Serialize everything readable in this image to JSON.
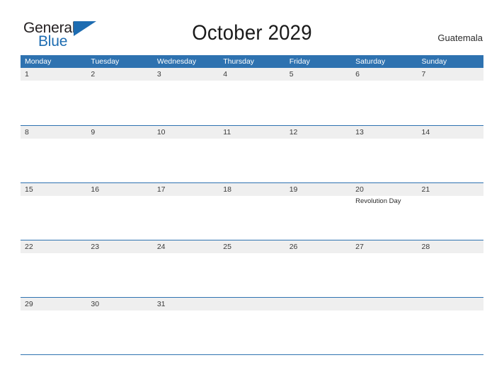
{
  "brand": {
    "name_part1": "General",
    "name_part2": "Blue",
    "triangle_icon": "triangle-icon",
    "accent_color": "#1d6cb1"
  },
  "header": {
    "title": "October 2029",
    "country": "Guatemala"
  },
  "colors": {
    "header_blue": "#2e72b0",
    "band_gray": "#efefef",
    "text_dark": "#3a3a3a"
  },
  "calendar": {
    "month": "October",
    "year": "2029",
    "weekdays": [
      "Monday",
      "Tuesday",
      "Wednesday",
      "Thursday",
      "Friday",
      "Saturday",
      "Sunday"
    ],
    "weeks": [
      {
        "days": [
          {
            "number": "1",
            "events": []
          },
          {
            "number": "2",
            "events": []
          },
          {
            "number": "3",
            "events": []
          },
          {
            "number": "4",
            "events": []
          },
          {
            "number": "5",
            "events": []
          },
          {
            "number": "6",
            "events": []
          },
          {
            "number": "7",
            "events": []
          }
        ]
      },
      {
        "days": [
          {
            "number": "8",
            "events": []
          },
          {
            "number": "9",
            "events": []
          },
          {
            "number": "10",
            "events": []
          },
          {
            "number": "11",
            "events": []
          },
          {
            "number": "12",
            "events": []
          },
          {
            "number": "13",
            "events": []
          },
          {
            "number": "14",
            "events": []
          }
        ]
      },
      {
        "days": [
          {
            "number": "15",
            "events": []
          },
          {
            "number": "16",
            "events": []
          },
          {
            "number": "17",
            "events": []
          },
          {
            "number": "18",
            "events": []
          },
          {
            "number": "19",
            "events": []
          },
          {
            "number": "20",
            "events": [
              "Revolution Day"
            ]
          },
          {
            "number": "21",
            "events": []
          }
        ]
      },
      {
        "days": [
          {
            "number": "22",
            "events": []
          },
          {
            "number": "23",
            "events": []
          },
          {
            "number": "24",
            "events": []
          },
          {
            "number": "25",
            "events": []
          },
          {
            "number": "26",
            "events": []
          },
          {
            "number": "27",
            "events": []
          },
          {
            "number": "28",
            "events": []
          }
        ]
      },
      {
        "days": [
          {
            "number": "29",
            "events": []
          },
          {
            "number": "30",
            "events": []
          },
          {
            "number": "31",
            "events": []
          },
          {
            "number": "",
            "events": []
          },
          {
            "number": "",
            "events": []
          },
          {
            "number": "",
            "events": []
          },
          {
            "number": "",
            "events": []
          }
        ]
      }
    ]
  }
}
